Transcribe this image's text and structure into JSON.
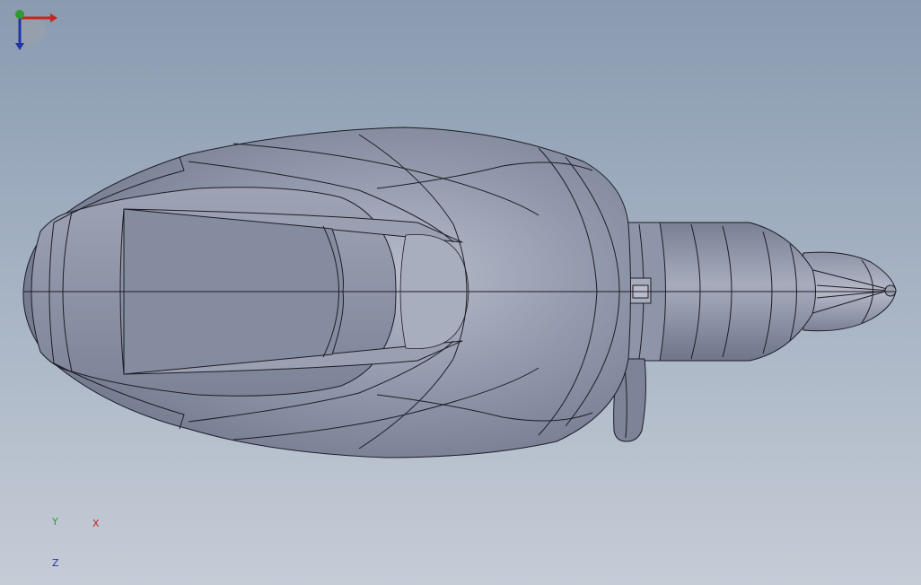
{
  "viewport": {
    "background_top": "#8a9bb0",
    "background_bottom": "#c6ccd6",
    "model_color": "#8b91a3",
    "edge_color": "#1c1d26"
  },
  "triad": {
    "x_label": "X",
    "y_label": "Y",
    "z_label": "Z",
    "x_color": "#c4281d",
    "y_color": "#2f9a2f",
    "z_color": "#2233aa"
  }
}
